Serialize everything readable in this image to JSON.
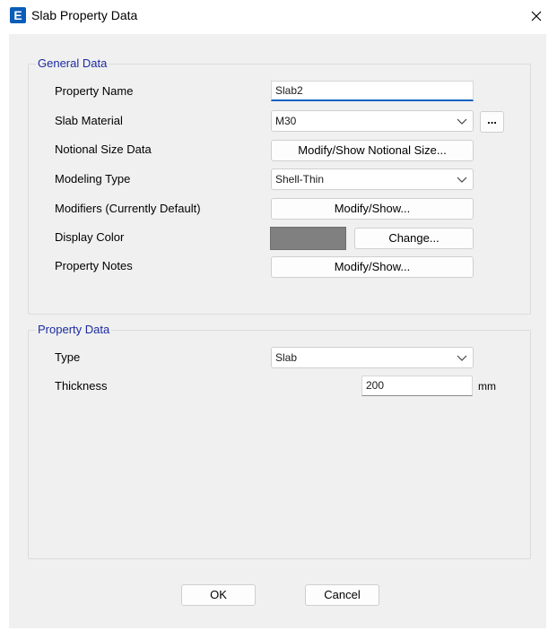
{
  "window": {
    "title": "Slab Property Data",
    "app_icon_letter": "E"
  },
  "general": {
    "legend": "General Data",
    "property_name": {
      "label": "Property Name",
      "value": "Slab2"
    },
    "slab_material": {
      "label": "Slab Material",
      "value": "M30",
      "browse_label": "..."
    },
    "notional_size": {
      "label": "Notional Size Data",
      "button": "Modify/Show Notional Size..."
    },
    "modeling_type": {
      "label": "Modeling Type",
      "value": "Shell-Thin"
    },
    "modifiers": {
      "label": "Modifiers (Currently Default)",
      "button": "Modify/Show..."
    },
    "display_color": {
      "label": "Display Color",
      "button": "Change...",
      "color": "#808080"
    },
    "property_notes": {
      "label": "Property Notes",
      "button": "Modify/Show..."
    }
  },
  "property": {
    "legend": "Property Data",
    "type": {
      "label": "Type",
      "value": "Slab"
    },
    "thickness": {
      "label": "Thickness",
      "value": "200",
      "unit": "mm"
    }
  },
  "footer": {
    "ok": "OK",
    "cancel": "Cancel"
  }
}
